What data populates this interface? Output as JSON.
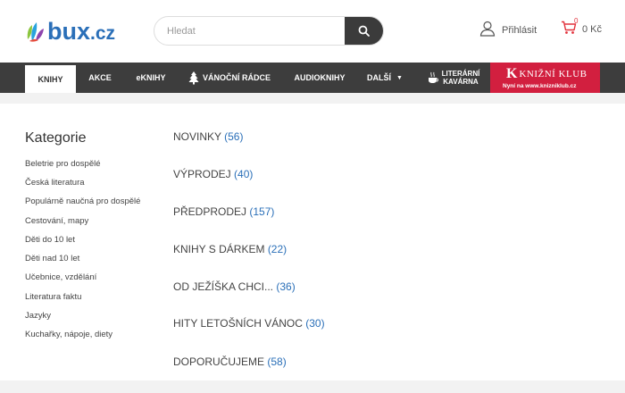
{
  "logo": {
    "text": "bux",
    "suffix": ".cz"
  },
  "search": {
    "placeholder": "Hledat"
  },
  "account": {
    "login_label": "Přihlásit"
  },
  "cart": {
    "count": "0",
    "total": "0 Kč"
  },
  "nav": {
    "items": [
      {
        "label": "KNIHY"
      },
      {
        "label": "AKCE"
      },
      {
        "label": "eKNIHY"
      },
      {
        "label": "VÁNOČNÍ RÁDCE"
      },
      {
        "label": "AUDIOKNIHY"
      },
      {
        "label": "DALŠÍ"
      },
      {
        "label_line1": "LITERÁRNÍ",
        "label_line2": "KAVÁRNA"
      }
    ],
    "club": {
      "name": "KNIŽNÍ KLUB",
      "letter": "K",
      "tagline": "Nyní na www.knizniklub.cz"
    }
  },
  "categories": {
    "title": "Kategorie",
    "items": [
      "Beletrie pro dospělé",
      "Česká literatura",
      "Populárně naučná pro dospělé",
      "Cestování, mapy",
      "Děti do 10 let",
      "Děti nad 10 let",
      "Učebnice, vzdělání",
      "Literatura faktu",
      "Jazyky",
      "Kuchařky, nápoje, diety"
    ]
  },
  "sections": [
    {
      "label": "NOVINKY",
      "count": "(56)"
    },
    {
      "label": "VÝPRODEJ",
      "count": "(40)"
    },
    {
      "label": "PŘEDPRODEJ",
      "count": "(157)"
    },
    {
      "label": "KNIHY S DÁRKEM",
      "count": "(22)"
    },
    {
      "label": "OD JEŽÍŠKA CHCI...",
      "count": "(36)"
    },
    {
      "label": "HITY LETOŠNÍCH VÁNOC",
      "count": "(30)"
    },
    {
      "label": "DOPORUČUJEME",
      "count": "(58)"
    }
  ],
  "colors": {
    "brand_blue": "#2a6fb8",
    "nav_bg": "#3d3d3d",
    "club_red": "#d21f3f",
    "cart_red": "#e2313b"
  }
}
